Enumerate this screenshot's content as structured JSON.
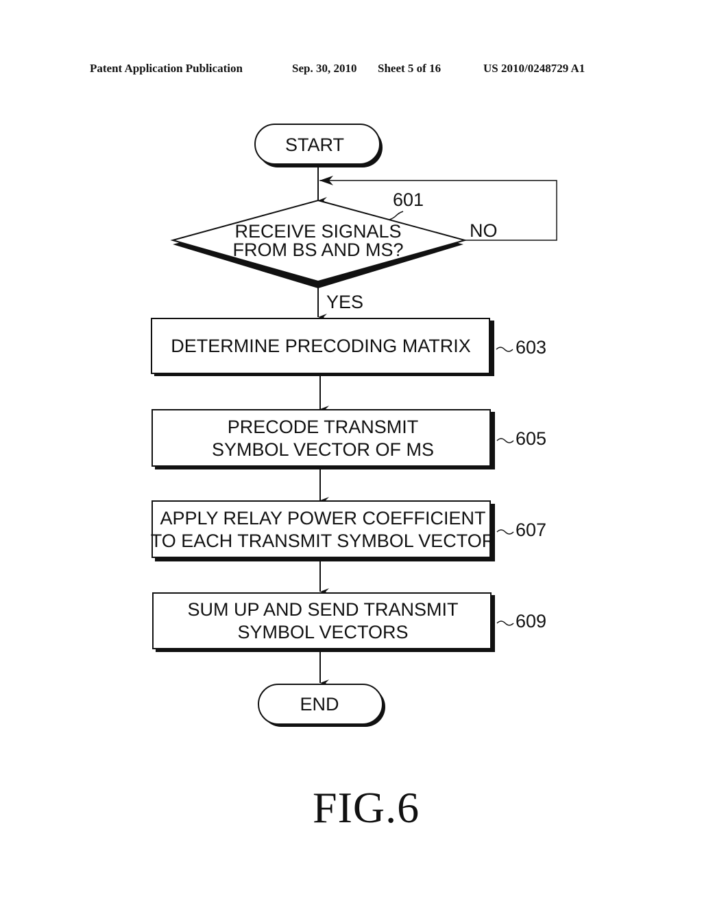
{
  "header": {
    "publication": "Patent Application Publication",
    "date": "Sep. 30, 2010",
    "sheet": "Sheet 5 of 16",
    "patent_number": "US 2010/0248729 A1"
  },
  "flowchart": {
    "start": "START",
    "decision": {
      "ref": "601",
      "line1": "RECEIVE SIGNALS",
      "line2": "FROM BS AND MS?",
      "no_label": "NO",
      "yes_label": "YES"
    },
    "steps": [
      {
        "ref": "603",
        "lines": [
          "DETERMINE PRECODING MATRIX"
        ]
      },
      {
        "ref": "605",
        "lines": [
          "PRECODE TRANSMIT",
          "SYMBOL VECTOR OF MS"
        ]
      },
      {
        "ref": "607",
        "lines": [
          "APPLY RELAY POWER COEFFICIENT",
          "TO EACH TRANSMIT SYMBOL VECTOR"
        ]
      },
      {
        "ref": "609",
        "lines": [
          "SUM UP AND SEND TRANSMIT",
          "SYMBOL VECTORS"
        ]
      }
    ],
    "end": "END"
  },
  "figure_label": "FIG.6"
}
